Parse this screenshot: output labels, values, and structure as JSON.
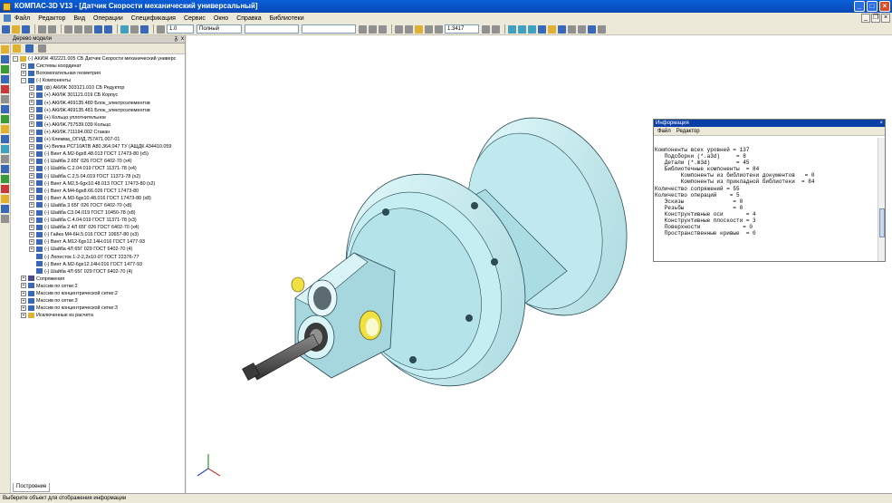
{
  "window": {
    "title": "КОМПАС-3D V13 - [Датчик Скорости механический универсальный]",
    "min": "_",
    "max": "□",
    "close": "×"
  },
  "menu": [
    "Файл",
    "Редактор",
    "Вид",
    "Операции",
    "Спецификация",
    "Сервис",
    "Окно",
    "Справка",
    "Библиотеки"
  ],
  "toolbar": {
    "linewidth": "1.0",
    "style": "Полный",
    "scale": "1.3417"
  },
  "panel": {
    "title": "Дерево модели",
    "pin": "ᵹ",
    "close": "x",
    "tab": "Построение"
  },
  "tree": [
    {
      "indent": 0,
      "exp": "-",
      "text": "(-) АКИЖ 402221.005 СБ Датчик Скорости механический универс",
      "icon": "asm"
    },
    {
      "indent": 1,
      "exp": "+",
      "text": "Системы координат",
      "icon": "axis"
    },
    {
      "indent": 1,
      "exp": "+",
      "text": "Вспомогательная геометрия",
      "icon": "geo"
    },
    {
      "indent": 1,
      "exp": "-",
      "text": "(-) Компоненты",
      "icon": "comp"
    },
    {
      "indent": 2,
      "exp": "+",
      "text": "(ф) АКИЖ 303121.010 СБ Редуктор",
      "icon": "part"
    },
    {
      "indent": 2,
      "exp": "+",
      "text": "(+) АКИЖ 301121.019 СБ Корпус",
      "icon": "part"
    },
    {
      "indent": 2,
      "exp": "+",
      "text": "(+) АКИЖ.469135.480 Блок_электроэлементов",
      "icon": "part"
    },
    {
      "indent": 2,
      "exp": "+",
      "text": "(+) АКИЖ.469135.481 Блок_электроэлементов",
      "icon": "part"
    },
    {
      "indent": 2,
      "exp": "+",
      "text": "(+) Кольцо уплотнительное",
      "icon": "part"
    },
    {
      "indent": 2,
      "exp": "+",
      "text": "(+) АКИЖ.757539.039 Кольцо",
      "icon": "part"
    },
    {
      "indent": 2,
      "exp": "+",
      "text": "(+) АКИЖ.711194.002 Стакан",
      "icon": "part"
    },
    {
      "indent": 2,
      "exp": "+",
      "text": "(+) Клемма_ОГИД.757471.007-01",
      "icon": "part"
    },
    {
      "indent": 2,
      "exp": "+",
      "text": "(+) Вилка РСГ10АТВ А80.364.047 ТУ (АЩДК.434410.059",
      "icon": "part"
    },
    {
      "indent": 2,
      "exp": "+",
      "text": "(-) Винт А.М2-6gx8.48.013 ГОСТ 17473-80 (х5)",
      "icon": "part"
    },
    {
      "indent": 2,
      "exp": "+",
      "text": "(-) Шайба 2.65Г 026 ГОСТ 6402-70 (х4)",
      "icon": "part"
    },
    {
      "indent": 2,
      "exp": "+",
      "text": "(-) Шайба С.2.04.019 ГОСТ 11371-78 (х4)",
      "icon": "part"
    },
    {
      "indent": 2,
      "exp": "+",
      "text": "(-) Шайба С.2,5.04.019 ГОСТ 11371-78 (х2)",
      "icon": "part"
    },
    {
      "indent": 2,
      "exp": "+",
      "text": "(-) Винт А.М2,5-6gx10.48.013 ГОСТ 17473-80 (х2)",
      "icon": "part"
    },
    {
      "indent": 2,
      "exp": "+",
      "text": "(-) Винт А.М4-6gx8.66.026 ГОСТ 17473-80",
      "icon": "part"
    },
    {
      "indent": 2,
      "exp": "+",
      "text": "(-) Винт А.М3-6gx10.48.016 ГОСТ 17473-80 (х8)",
      "icon": "part"
    },
    {
      "indent": 2,
      "exp": "+",
      "text": "(-) Шайба 3 65Г 026 ГОСТ 6402-70 (х8)",
      "icon": "part"
    },
    {
      "indent": 2,
      "exp": "+",
      "text": "(-) Шайба С3.04.019 ГОСТ 10450-78 (х8)",
      "icon": "part"
    },
    {
      "indent": 2,
      "exp": "+",
      "text": "(-) Шайба С.4.04.019 ГОСТ 11371-78 (х3)",
      "icon": "part"
    },
    {
      "indent": 2,
      "exp": "+",
      "text": "(-) Шайба 2 4Л 65Г 026 ГОСТ 6402-70 (х4)",
      "icon": "part"
    },
    {
      "indent": 2,
      "exp": "+",
      "text": "(-) Гайка М4-6Н.5.016 ГОСТ 10657-80 (х3)",
      "icon": "part"
    },
    {
      "indent": 2,
      "exp": "+",
      "text": "(-) Винт А.М12-6gx12.14Н.016 ГОСТ 1477-93",
      "icon": "part"
    },
    {
      "indent": 2,
      "exp": "+",
      "text": "(-) Шайба 4Л 65Г 029 ГОСТ 6402-70 (4)",
      "icon": "part"
    },
    {
      "indent": 2,
      "exp": "",
      "text": "(-) Лепесток 1-2-2,2х10-07 ГОСТ 22376-77",
      "icon": "part"
    },
    {
      "indent": 2,
      "exp": "",
      "text": "(-) Винт А.М2-6gx12.14Н.016 ГОСТ 1477-93",
      "icon": "part"
    },
    {
      "indent": 2,
      "exp": "",
      "text": "(-) Шайба 4Л 65Г 029 ГОСТ 6402-70 (4)",
      "icon": "part"
    },
    {
      "indent": 1,
      "exp": "+",
      "text": "Сопряжения",
      "icon": "mate"
    },
    {
      "indent": 1,
      "exp": "+",
      "text": "Массив по сетке:2",
      "icon": "grid"
    },
    {
      "indent": 1,
      "exp": "+",
      "text": "Массив по концентрической сетке:2",
      "icon": "conc"
    },
    {
      "indent": 1,
      "exp": "+",
      "text": "Массив по сетке:3",
      "icon": "grid"
    },
    {
      "indent": 1,
      "exp": "+",
      "text": "Массив по концентрической сетке:3",
      "icon": "conc"
    },
    {
      "indent": 1,
      "exp": "+",
      "text": "Исключенные из расчета",
      "icon": "excl"
    }
  ],
  "info": {
    "title": "Информация",
    "close": "×",
    "menu": [
      "Файл",
      "Редактор"
    ],
    "lines": [
      "Компоненты всех уровней = 137",
      "   Подсборки (*.a3d)     = 8",
      "   Детали (*.m3d)        = 45",
      "   Библиотечные компоненты  = 84",
      "        Компоненты из библиотеки документов   = 0",
      "        Компоненты из прикладной библиотеки  = 84",
      "Количество сопряжений = 55",
      "Количество операций    = 5",
      "   Эскизы               = 0",
      "   Резьбы               = 0",
      "   Конструктивные оси       = 4",
      "   Конструктивные плоскости = 3",
      "   Поверхности             = 0",
      "   Пространственные кривые  = 0"
    ]
  },
  "status": "Выберите объект для отображения информации",
  "colors": {
    "model": "#c9eef0",
    "modelDark": "#7fb8c4",
    "shaft": "#4a4a4a",
    "accent": "#e8d030"
  }
}
